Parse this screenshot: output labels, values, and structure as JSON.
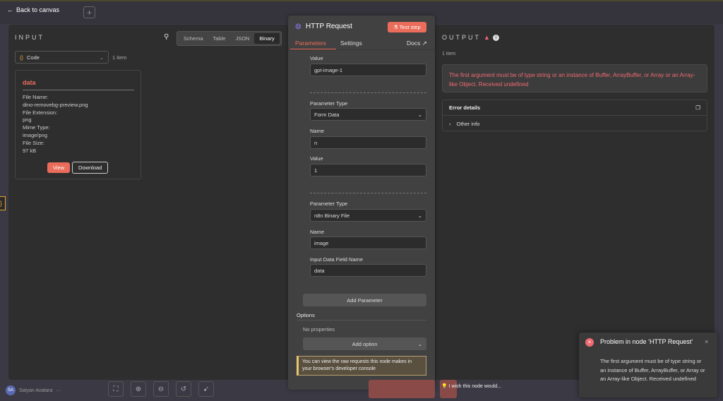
{
  "topbar": {
    "back_label": "Back to canvas",
    "plus": "+"
  },
  "input": {
    "title": "INPUT",
    "tabs": [
      "Schema",
      "Table",
      "JSON",
      "Binary"
    ],
    "active_tab": "Binary",
    "source_node": "Code",
    "item_count": "1 item",
    "binary": {
      "name": "data",
      "fields": [
        {
          "label": "File Name:",
          "value": "dino-removebg-preview.png"
        },
        {
          "label": "File Extension:",
          "value": "png"
        },
        {
          "label": "Mime Type:",
          "value": "image/png"
        },
        {
          "label": "File Size:",
          "value": "97 kB"
        }
      ],
      "view_label": "View",
      "download_label": "Download"
    }
  },
  "node": {
    "title": "HTTP Request",
    "test_label": "Test step",
    "tabs": [
      "Parameters",
      "Settings"
    ],
    "docs_label": "Docs",
    "fields": [
      {
        "label": "Value",
        "value": "gpt-image-1"
      },
      {
        "label": "Parameter Type",
        "value": "Form Data"
      },
      {
        "label": "Name",
        "value": "n"
      },
      {
        "label": "Value",
        "value": "1"
      },
      {
        "label": "Parameter Type",
        "value": "n8n Binary File"
      },
      {
        "label": "Name",
        "value": "image"
      },
      {
        "label": "Input Data Field Name",
        "value": "data"
      }
    ],
    "add_parameter": "Add Parameter",
    "options_label": "Options",
    "no_properties": "No properties",
    "add_option": "Add option",
    "hint": "You can view the raw requests this node makes in your browser's developer console"
  },
  "output": {
    "title": "OUTPUT",
    "item_count": "1 item",
    "error_message": "The first argument must be of type string or an instance of Buffer, ArrayBuffer, or Array or an Array-like Object. Received undefined",
    "error_details": "Error details",
    "other_info": "Other info"
  },
  "bottom": {
    "user_initials": "SA",
    "user_name": "Satyan Avatara",
    "more": "···",
    "feedback": "I wish this node would..."
  },
  "toast": {
    "title": "Problem in node ‘HTTP Request‘",
    "body": "The first argument must be of type string or an instance of Buffer, ArrayBuffer, or Array or an Array-like Object. Received undefined"
  },
  "colors": {
    "accent": "#ea6d5b",
    "error": "#f06a72"
  }
}
